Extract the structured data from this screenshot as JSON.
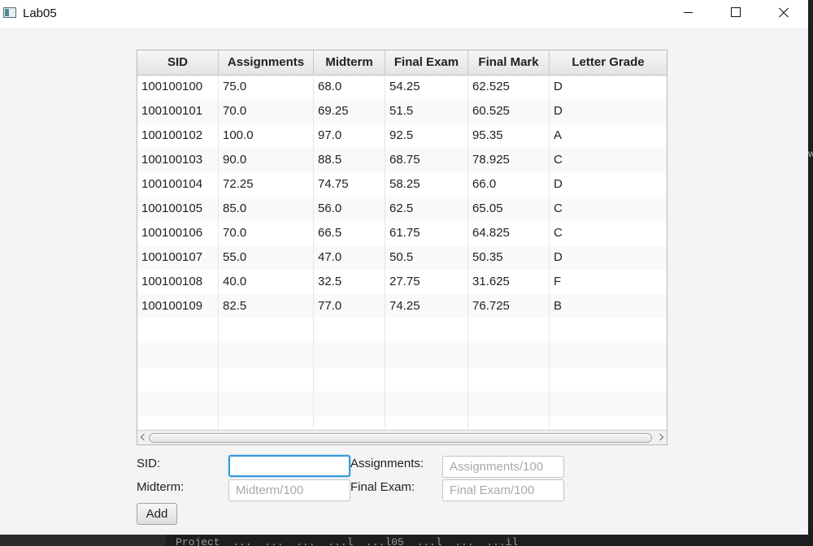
{
  "window": {
    "title": "Lab05",
    "icon": "app-window-icon",
    "controls": [
      "minimize-icon",
      "maximize-icon",
      "close-icon"
    ]
  },
  "table": {
    "columns": [
      "SID",
      "Assignments",
      "Midterm",
      "Final Exam",
      "Final Mark",
      "Letter Grade"
    ],
    "rows": [
      [
        "100100100",
        "75.0",
        "68.0",
        "54.25",
        "62.525",
        "D"
      ],
      [
        "100100101",
        "70.0",
        "69.25",
        "51.5",
        "60.525",
        "D"
      ],
      [
        "100100102",
        "100.0",
        "97.0",
        "92.5",
        "95.35",
        "A"
      ],
      [
        "100100103",
        "90.0",
        "88.5",
        "68.75",
        "78.925",
        "C"
      ],
      [
        "100100104",
        "72.25",
        "74.75",
        "58.25",
        "66.0",
        "D"
      ],
      [
        "100100105",
        "85.0",
        "56.0",
        "62.5",
        "65.05",
        "C"
      ],
      [
        "100100106",
        "70.0",
        "66.5",
        "61.75",
        "64.825",
        "C"
      ],
      [
        "100100107",
        "55.0",
        "47.0",
        "50.5",
        "50.35",
        "D"
      ],
      [
        "100100108",
        "40.0",
        "32.5",
        "27.75",
        "31.625",
        "F"
      ],
      [
        "100100109",
        "82.5",
        "77.0",
        "74.25",
        "76.725",
        "B"
      ]
    ]
  },
  "form": {
    "sid_label": "SID:",
    "sid_value": "",
    "assignments_label": "Assignments:",
    "assignments_placeholder": "Assignments/100",
    "midterm_label": "Midterm:",
    "midterm_placeholder": "Midterm/100",
    "final_label": "Final Exam:",
    "final_placeholder": "Final Exam/100",
    "add_label": "Add"
  },
  "background": {
    "bottom_text": "Project  ...  ...  ...  ...l  ...l05  ...l  ...  ...il",
    "right_char": "w"
  },
  "colors": {
    "focus": "#3a99d8",
    "header_bg": "#e4e4e4",
    "window_bg": "#f4f4f4"
  }
}
